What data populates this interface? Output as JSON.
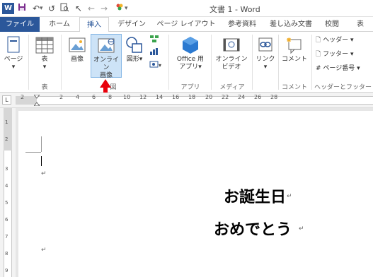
{
  "window": {
    "title": "文書 1 - Word"
  },
  "quick_access": [
    "word-logo",
    "save-icon",
    "undo-icon",
    "redo-icon",
    "print-preview-icon",
    "pointer-icon",
    "back-icon",
    "color-icon"
  ],
  "tabs": [
    {
      "label": "ファイル",
      "active": false
    },
    {
      "label": "ホーム",
      "active": false
    },
    {
      "label": "挿入",
      "active": true
    },
    {
      "label": "デザイン",
      "active": false
    },
    {
      "label": "ページ レイアウト",
      "active": false
    },
    {
      "label": "参考資料",
      "active": false
    },
    {
      "label": "差し込み文書",
      "active": false
    },
    {
      "label": "校閲",
      "active": false
    },
    {
      "label": "表",
      "active": false
    }
  ],
  "ribbon": {
    "pages": {
      "label": "ページ"
    },
    "table": {
      "label": "表",
      "group": "表"
    },
    "illustrations": {
      "picture": "画像",
      "online_picture_line1": "オンライン",
      "online_picture_line2": "画像",
      "shapes": "図形",
      "group": "図"
    },
    "apps": {
      "office_line1": "Office 用",
      "office_line2": "アプリ",
      "group": "アプリ"
    },
    "media": {
      "video_line1": "オンライン",
      "video_line2": "ビデオ",
      "group": "メディア"
    },
    "links": {
      "label": "リンク"
    },
    "comments": {
      "label": "コメント",
      "group": "コメント"
    },
    "header_footer": {
      "header": "ヘッダー",
      "footer": "フッター",
      "page_number": "ページ番号",
      "group": "ヘッダーとフッター"
    }
  },
  "ruler": {
    "tab_selector": "L",
    "numbers": [
      "2",
      "2",
      "4",
      "6",
      "8",
      "10",
      "12",
      "14",
      "16",
      "18",
      "20",
      "22",
      "24",
      "26",
      "28"
    ],
    "vnumbers": [
      "1",
      "2",
      "3",
      "4",
      "5",
      "6",
      "7",
      "8",
      "9"
    ]
  },
  "document": {
    "line1": "お誕生日",
    "line2": "おめでとう",
    "para_mark": "↵"
  },
  "colors": {
    "accent": "#2b579a",
    "arrow": "#e8000b",
    "selected_button": "#cde3f7"
  }
}
